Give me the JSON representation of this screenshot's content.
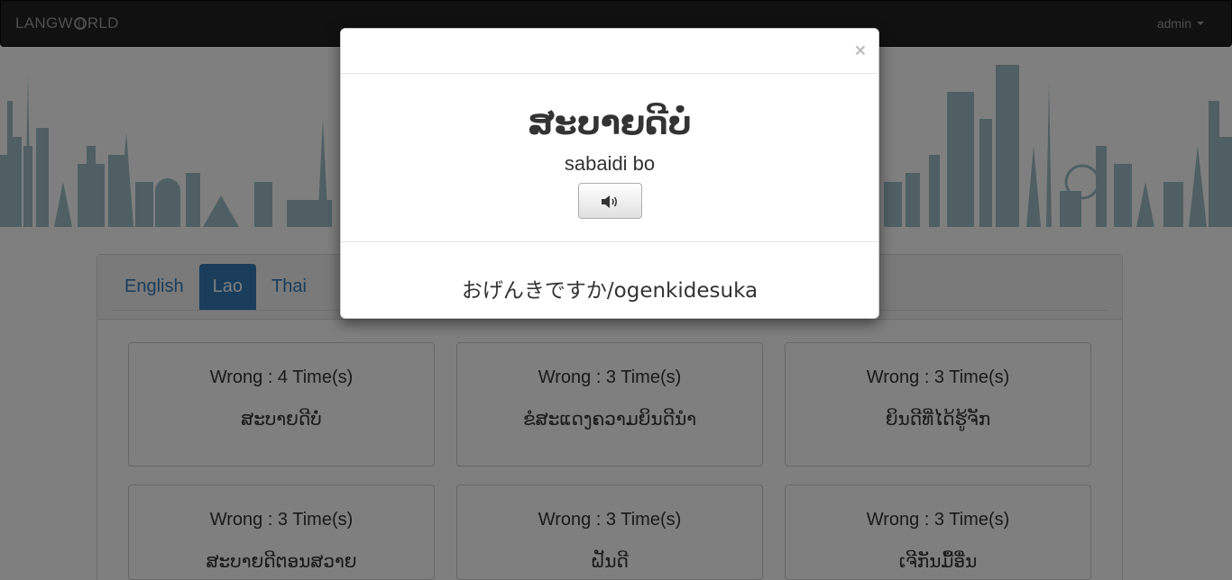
{
  "navbar": {
    "brand_prefix": "LANGW",
    "brand_suffix": "RLD",
    "user": "admin"
  },
  "tabs": [
    "English",
    "Lao",
    "Thai"
  ],
  "active_tab": "Lao",
  "cards": [
    {
      "wrong": "Wrong : 4 Time(s)",
      "word": "ສະບາຍດີບໍ່"
    },
    {
      "wrong": "Wrong : 3 Time(s)",
      "word": "ຂໍສະແດງຄວາມຍິນດີນໍາ"
    },
    {
      "wrong": "Wrong : 3 Time(s)",
      "word": "ຍິນດີທີ່ໄດ້ຮູ້ຈັກ"
    },
    {
      "wrong": "Wrong : 3 Time(s)",
      "word": "ສະບາຍດີຕອນສວາຍ"
    },
    {
      "wrong": "Wrong : 3 Time(s)",
      "word": "ຝັນດີ"
    },
    {
      "wrong": "Wrong : 3 Time(s)",
      "word": "ເຈີກັນມື້ອື່ນ"
    }
  ],
  "modal": {
    "close_label": "×",
    "word": "ສະບາຍດີບໍ່",
    "romanized": "sabaidi bo",
    "sound_icon": "speaker-icon",
    "translation": "おげんきですか/ogenkidesuka"
  },
  "colors": {
    "navbar": "#222222",
    "active_tab": "#337ab7",
    "skyline": "#7fa8b3"
  }
}
